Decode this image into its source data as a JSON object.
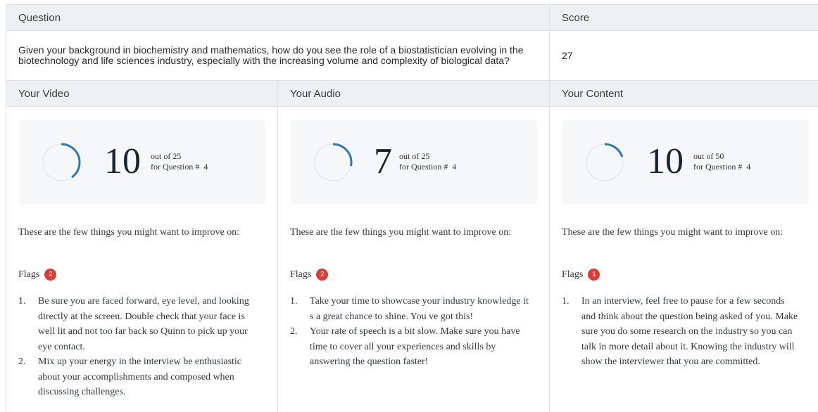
{
  "question_table": {
    "headers": {
      "question": "Question",
      "score": "Score"
    },
    "question_text": "Given your background in biochemistry and mathematics, how do you see the role of a biostatistician evolving in the biotechnology and life sciences industry, especially with the increasing volume and complexity of biological data?",
    "score_value": "27"
  },
  "sections": {
    "video": {
      "header": "Your Video",
      "score": "10",
      "out_of": "out of 25",
      "for_question": "for Question #  4",
      "progress_fraction": 0.4,
      "improve_text": "These are the few things you might want to improve on:",
      "flags_label": "Flags",
      "flags_count": "2",
      "items": [
        {
          "num": "1.",
          "text": "Be sure you are faced forward, eye level, and looking directly at the screen. Double check that your face is well lit and not too far back so Quinn to pick up your eye contact."
        },
        {
          "num": "2.",
          "text": "Mix up your energy in the interview be enthusiastic about your accomplishments and composed when discussing challenges."
        }
      ]
    },
    "audio": {
      "header": "Your Audio",
      "score": "7",
      "out_of": "out of 25",
      "for_question": "for Question #  4",
      "progress_fraction": 0.28,
      "improve_text": "These are the few things you might want to improve on:",
      "flags_label": "Flags",
      "flags_count": "2",
      "items": [
        {
          "num": "1.",
          "text": "Take your time to showcase your industry knowledge it s a great chance to shine. You ve got this!"
        },
        {
          "num": "2.",
          "text": "Your rate of speech is a bit slow. Make sure you have time to cover all your experiences and skills by answering the question faster!"
        }
      ]
    },
    "content": {
      "header": "Your Content",
      "score": "10",
      "out_of": "out of 50",
      "for_question": "for Question #  4",
      "progress_fraction": 0.2,
      "improve_text": "These are the few things you might want to improve on:",
      "flags_label": "Flags",
      "flags_count": "1",
      "items": [
        {
          "num": "1.",
          "text": "In an interview, feel free to pause for a few seconds and think about the question being asked of you. Make sure you do some research on the industry so you can talk in more detail about it. Knowing the industry will show the interviewer that you are committed."
        }
      ]
    }
  },
  "colors": {
    "ring_progress": "#2a7ab8",
    "ring_track": "#dde1e5",
    "badge": "#e03a32",
    "header_bg": "#eef1f4"
  }
}
